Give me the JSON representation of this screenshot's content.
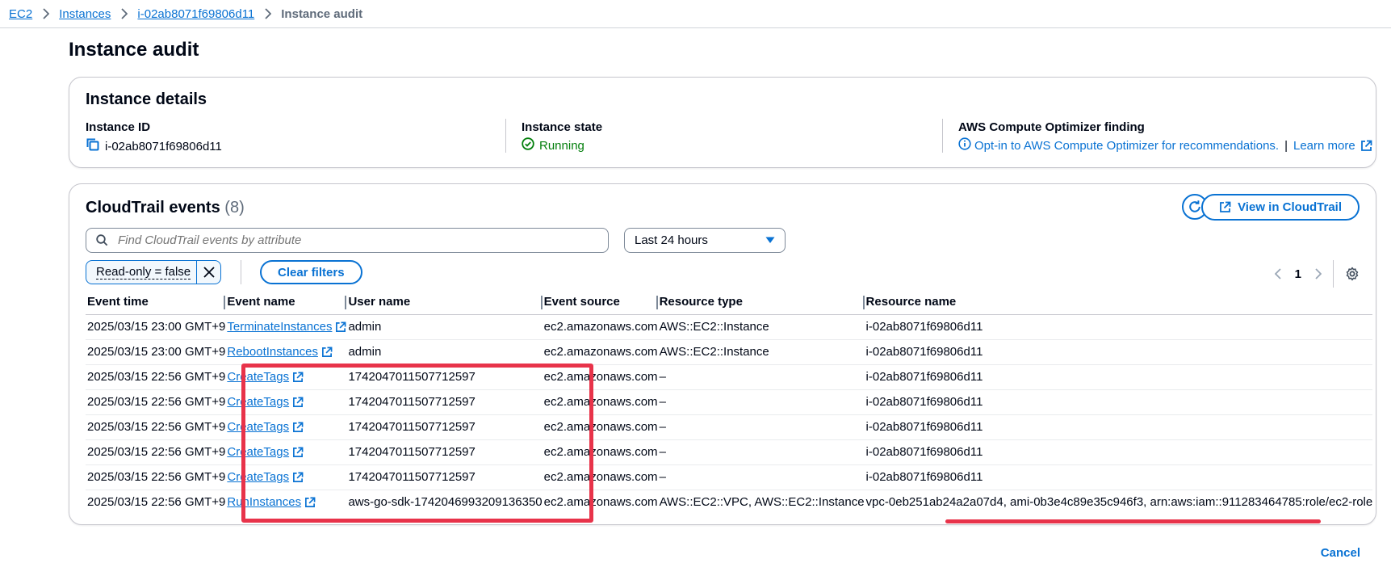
{
  "breadcrumb": {
    "items": [
      "EC2",
      "Instances",
      "i-02ab8071f69806d11"
    ],
    "current": "Instance audit"
  },
  "page": {
    "title": "Instance audit"
  },
  "details": {
    "title": "Instance details",
    "instance_id_label": "Instance ID",
    "instance_id": "i-02ab8071f69806d11",
    "state_label": "Instance state",
    "state": "Running",
    "optimizer_label": "AWS Compute Optimizer finding",
    "optimizer_link": "Opt-in to AWS Compute Optimizer for recommendations.",
    "separator": "|",
    "learn_more": "Learn more"
  },
  "events": {
    "title": "CloudTrail events",
    "count": "(8)",
    "view_button": "View in CloudTrail",
    "search_placeholder": "Find CloudTrail events by attribute",
    "time_range": "Last 24 hours",
    "filter_token": "Read-only = false",
    "clear_filters": "Clear filters",
    "page_number": "1",
    "columns": [
      "Event time",
      "Event name",
      "User name",
      "Event source",
      "Resource type",
      "Resource name"
    ],
    "rows": [
      [
        "2025/03/15 23:00 GMT+9",
        "TerminateInstances",
        "admin",
        "ec2.amazonaws.com",
        "AWS::EC2::Instance",
        "i-02ab8071f69806d11"
      ],
      [
        "2025/03/15 23:00 GMT+9",
        "RebootInstances",
        "admin",
        "ec2.amazonaws.com",
        "AWS::EC2::Instance",
        "i-02ab8071f69806d11"
      ],
      [
        "2025/03/15 22:56 GMT+9",
        "CreateTags",
        "1742047011507712597",
        "ec2.amazonaws.com",
        "–",
        "i-02ab8071f69806d11"
      ],
      [
        "2025/03/15 22:56 GMT+9",
        "CreateTags",
        "1742047011507712597",
        "ec2.amazonaws.com",
        "–",
        "i-02ab8071f69806d11"
      ],
      [
        "2025/03/15 22:56 GMT+9",
        "CreateTags",
        "1742047011507712597",
        "ec2.amazonaws.com",
        "–",
        "i-02ab8071f69806d11"
      ],
      [
        "2025/03/15 22:56 GMT+9",
        "CreateTags",
        "1742047011507712597",
        "ec2.amazonaws.com",
        "–",
        "i-02ab8071f69806d11"
      ],
      [
        "2025/03/15 22:56 GMT+9",
        "CreateTags",
        "1742047011507712597",
        "ec2.amazonaws.com",
        "–",
        "i-02ab8071f69806d11"
      ],
      [
        "2025/03/15 22:56 GMT+9",
        "RunInstances",
        "aws-go-sdk-1742046993209136350",
        "ec2.amazonaws.com",
        "AWS::EC2::VPC, AWS::EC2::Instance",
        "vpc-0eb251ab24a2a07d4, ami-0b3e4c89e35c946f3, arn:aws:iam::911283464785:role/ec2-role"
      ]
    ]
  },
  "footer": {
    "cancel": "Cancel"
  },
  "colors": {
    "link": "#0972d3",
    "success": "#037f0c",
    "annotation": "#e8334a"
  }
}
